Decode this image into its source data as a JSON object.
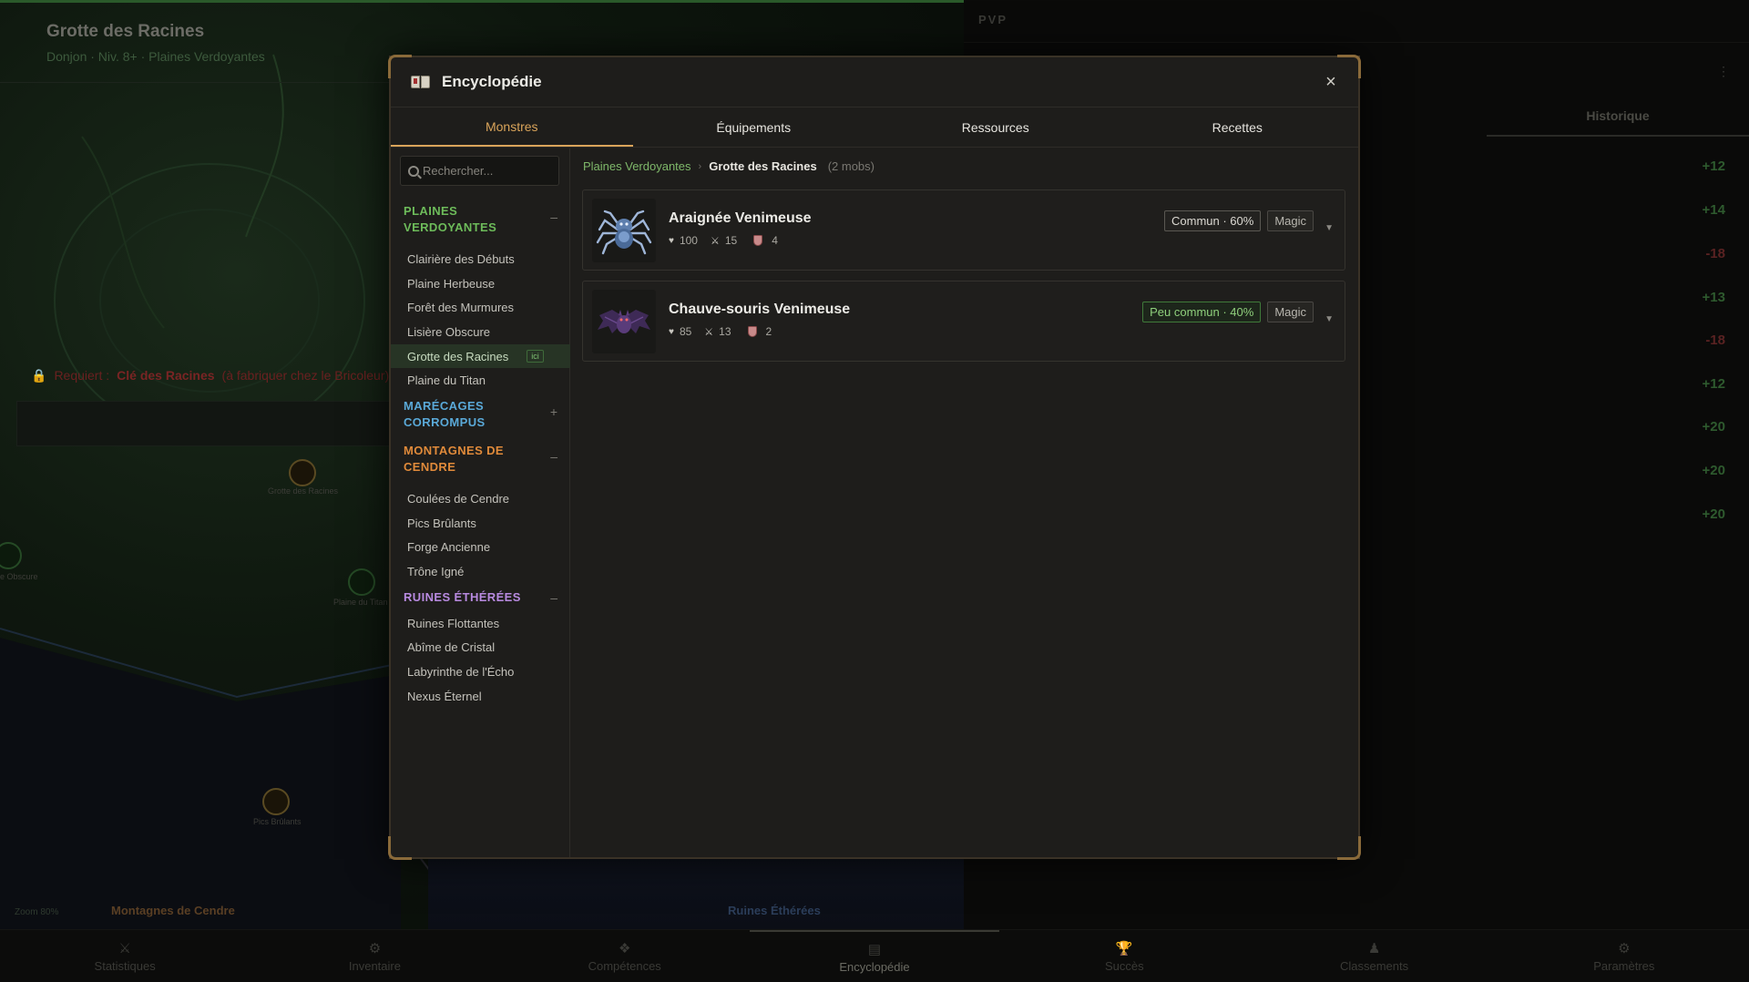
{
  "background": {
    "title": "Grotte des Racines",
    "subtitle": "Donjon · Niv. 8+ · Plaines Verdoyantes",
    "lock_text_prefix": "Requiert :",
    "lock_key": "Clé des Racines",
    "lock_suffix": "(à fabriquer chez le Bricoleur)",
    "map_nodes": [
      "Grotte des Racines",
      "Plaine du Titan",
      "Pics Brûlants",
      "e Obscure"
    ],
    "region_labels": [
      "Montagnes de Cendre",
      "Ruines Éthérées"
    ],
    "zoom": "Zoom 80%",
    "pvp_label": "PVP",
    "history_tab": "Historique",
    "ellipsis": "⋮",
    "scores": [
      "+12",
      "+14",
      "-18",
      "+13",
      "-18",
      "+12",
      "+20",
      "+20",
      "+20"
    ]
  },
  "nav": [
    {
      "label": "Statistiques",
      "icon": "⚔"
    },
    {
      "label": "Inventaire",
      "icon": "⚙"
    },
    {
      "label": "Compétences",
      "icon": "❖"
    },
    {
      "label": "Encyclopédie",
      "icon": "▤"
    },
    {
      "label": "Succès",
      "icon": "🏆"
    },
    {
      "label": "Classements",
      "icon": "♟"
    },
    {
      "label": "Paramètres",
      "icon": "⚙"
    }
  ],
  "modal": {
    "title": "Encyclopédie",
    "close": "×",
    "tabs": [
      {
        "label": "Monstres",
        "active": true
      },
      {
        "label": "Équipements"
      },
      {
        "label": "Ressources"
      },
      {
        "label": "Recettes"
      }
    ],
    "search": {
      "placeholder": "Rechercher..."
    },
    "regions": [
      {
        "name": "PLAINES VERDOYANTES",
        "color": "#6dbb5a",
        "toggle": "–",
        "zones": [
          "Clairière des Débuts",
          "Plaine Herbeuse",
          "Forêt des Murmures",
          "Lisière Obscure",
          "Grotte des Racines",
          "Plaine du Titan"
        ],
        "active_zone": "Grotte des Racines",
        "here_badge": "ici"
      },
      {
        "name": "MARÉCAGES CORROMPUS",
        "color": "#5aa9d8",
        "toggle": "+",
        "zones": []
      },
      {
        "name": "MONTAGNES DE CENDRE",
        "color": "#e08a3a",
        "toggle": "–",
        "zones": [
          "Coulées de Cendre",
          "Pics Brûlants",
          "Forge Ancienne",
          "Trône Igné"
        ]
      },
      {
        "name": "RUINES ÉTHÉRÉES",
        "color": "#b88ae0",
        "toggle": "–",
        "zones": [
          "Ruines Flottantes",
          "Abîme de Cristal",
          "Labyrinthe de l'Écho",
          "Nexus Éternel"
        ]
      }
    ],
    "breadcrumb": {
      "region": "Plaines Verdoyantes",
      "separator": "›",
      "zone": "Grotte des Racines",
      "count": "(2 mobs)"
    },
    "mobs": [
      {
        "name": "Araignée Venimeuse",
        "hp": "100",
        "attack": "15",
        "defense": "4",
        "rarity": "Commun · 60%",
        "rarity_class": "common",
        "type": "Magic",
        "portrait": "spider"
      },
      {
        "name": "Chauve-souris Venimeuse",
        "hp": "85",
        "attack": "13",
        "defense": "2",
        "rarity": "Peu commun · 40%",
        "rarity_class": "uncommon",
        "type": "Magic",
        "portrait": "bat"
      }
    ]
  }
}
